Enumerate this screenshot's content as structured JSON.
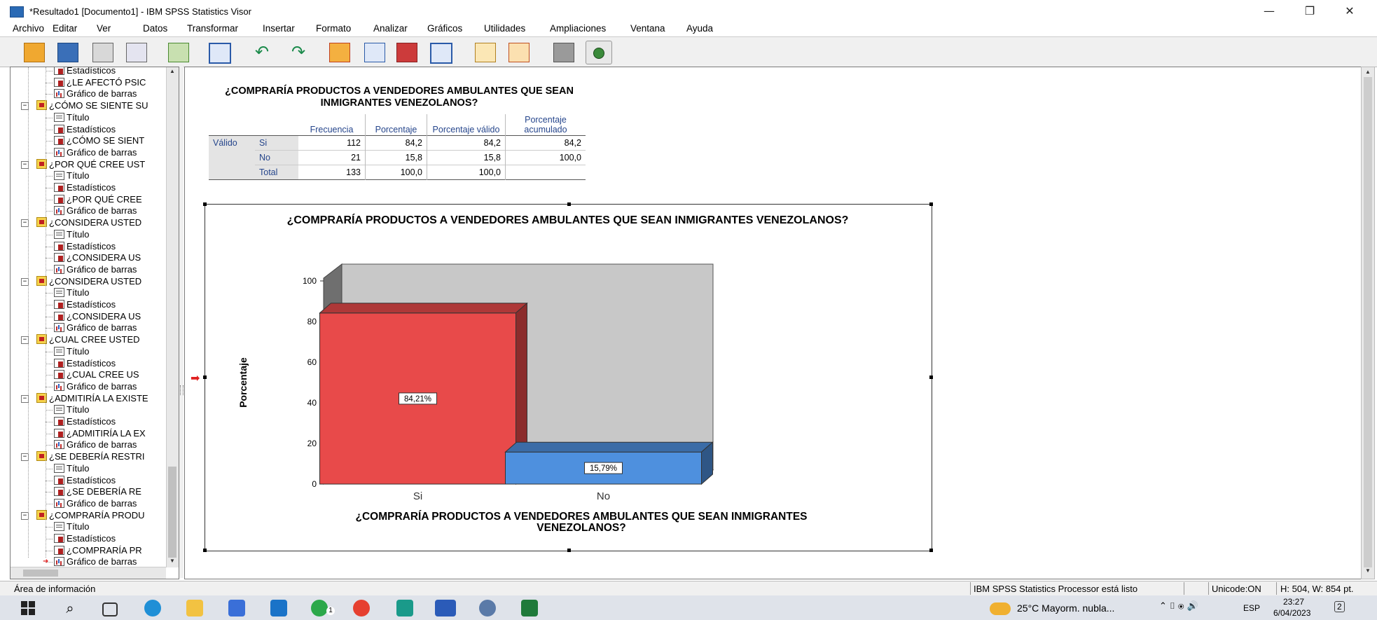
{
  "window": {
    "title": "*Resultado1 [Documento1] - IBM SPSS Statistics Visor",
    "minimize": "—",
    "restore": "❐",
    "close": "✕"
  },
  "menu": [
    "Archivo",
    "Editar",
    "Ver",
    "Datos",
    "Transformar",
    "Insertar",
    "Formato",
    "Analizar",
    "Gráficos",
    "Utilidades",
    "Ampliaciones",
    "Ventana",
    "Ayuda"
  ],
  "toolbar": [
    "open-icon",
    "save-icon",
    "print-icon",
    "print-preview-icon",
    "export-icon",
    "recall-dialog-icon",
    "undo-icon",
    "redo-icon",
    "goto-data-icon",
    "goto-case-icon",
    "variables-icon",
    "select-cases-icon",
    "insert-heading-icon",
    "insert-text-icon",
    "hide-icon",
    "show-icon"
  ],
  "nav": {
    "rows": [
      {
        "label": "Estadísticos",
        "type": "table"
      },
      {
        "label": "¿LE AFECTÓ PSIC",
        "type": "table"
      },
      {
        "label": "Gráfico de barras",
        "type": "chart"
      },
      {
        "label": "¿CÓMO SE SIENTE SU",
        "type": "folder"
      },
      {
        "label": "Título",
        "type": "title"
      },
      {
        "label": "Estadísticos",
        "type": "table"
      },
      {
        "label": "¿CÓMO SE SIENT",
        "type": "table"
      },
      {
        "label": "Gráfico de barras",
        "type": "chart"
      },
      {
        "label": "¿POR QUÉ CREE UST",
        "type": "folder"
      },
      {
        "label": "Título",
        "type": "title"
      },
      {
        "label": "Estadísticos",
        "type": "table"
      },
      {
        "label": "¿POR QUÉ CREE",
        "type": "table"
      },
      {
        "label": "Gráfico de barras",
        "type": "chart"
      },
      {
        "label": "¿CONSIDERA USTED",
        "type": "folder"
      },
      {
        "label": "Título",
        "type": "title"
      },
      {
        "label": "Estadísticos",
        "type": "table"
      },
      {
        "label": "¿CONSIDERA US",
        "type": "table"
      },
      {
        "label": "Gráfico de barras",
        "type": "chart"
      },
      {
        "label": "¿CONSIDERA USTED",
        "type": "folder"
      },
      {
        "label": "Título",
        "type": "title"
      },
      {
        "label": "Estadísticos",
        "type": "table"
      },
      {
        "label": "¿CONSIDERA US",
        "type": "table"
      },
      {
        "label": "Gráfico de barras",
        "type": "chart"
      },
      {
        "label": "¿CUAL CREE USTED",
        "type": "folder"
      },
      {
        "label": "Título",
        "type": "title"
      },
      {
        "label": "Estadísticos",
        "type": "table"
      },
      {
        "label": "¿CUAL CREE US",
        "type": "table"
      },
      {
        "label": "Gráfico de barras",
        "type": "chart"
      },
      {
        "label": "¿ADMITIRÍA LA EXISTE",
        "type": "folder"
      },
      {
        "label": "Título",
        "type": "title"
      },
      {
        "label": "Estadísticos",
        "type": "table"
      },
      {
        "label": "¿ADMITIRÍA LA EX",
        "type": "table"
      },
      {
        "label": "Gráfico de barras",
        "type": "chart"
      },
      {
        "label": "¿SE DEBERÍA RESTRI",
        "type": "folder"
      },
      {
        "label": "Título",
        "type": "title"
      },
      {
        "label": "Estadísticos",
        "type": "table"
      },
      {
        "label": "¿SE DEBERÍA RE",
        "type": "table"
      },
      {
        "label": "Gráfico de barras",
        "type": "chart"
      },
      {
        "label": "¿COMPRARÍA PRODU",
        "type": "folder"
      },
      {
        "label": "Título",
        "type": "title"
      },
      {
        "label": "Estadísticos",
        "type": "table"
      },
      {
        "label": "¿COMPRARÍA PR",
        "type": "table"
      },
      {
        "label": "Gráfico de barras",
        "type": "chart"
      }
    ]
  },
  "freq_table": {
    "title": "¿COMPRARÍA PRODUCTOS A VENDEDORES AMBULANTES QUE SEAN INMIGRANTES VENEZOLANOS?",
    "headers": [
      "Frecuencia",
      "Porcentaje",
      "Porcentaje válido",
      "Porcentaje acumulado"
    ],
    "group_label": "Válido",
    "rows": [
      {
        "label": "Si",
        "frecuencia": "112",
        "porcentaje": "84,2",
        "valido": "84,2",
        "acumulado": "84,2"
      },
      {
        "label": "No",
        "frecuencia": "21",
        "porcentaje": "15,8",
        "valido": "15,8",
        "acumulado": "100,0"
      },
      {
        "label": "Total",
        "frecuencia": "133",
        "porcentaje": "100,0",
        "valido": "100,0",
        "acumulado": ""
      }
    ]
  },
  "chart_data": {
    "type": "bar",
    "title": "¿COMPRARÍA PRODUCTOS A VENDEDORES AMBULANTES QUE SEAN INMIGRANTES VENEZOLANOS?",
    "xlabel": "¿COMPRARÍA PRODUCTOS A VENDEDORES AMBULANTES QUE SEAN INMIGRANTES VENEZOLANOS?",
    "ylabel": "Porcentaje",
    "categories": [
      "Si",
      "No"
    ],
    "values": [
      84.21,
      15.79
    ],
    "data_labels": [
      "84,21%",
      "15,79%"
    ],
    "yticks": [
      0,
      20,
      40,
      60,
      80,
      100
    ],
    "ylim": [
      0,
      100
    ],
    "colors": [
      "#e84a4a",
      "#4e90de"
    ],
    "style": "3d"
  },
  "status": {
    "info": "Área de información",
    "processor": "IBM SPSS Statistics Processor está listo",
    "unicode": "Unicode:ON",
    "size": "H: 504, W: 854 pt."
  },
  "taskbar": {
    "weather": "25°C  Mayorm. nubla...",
    "lang": "ESP",
    "time": "23:27",
    "date": "6/04/2023",
    "notifications": "2",
    "whatsapp_badge": "1"
  }
}
